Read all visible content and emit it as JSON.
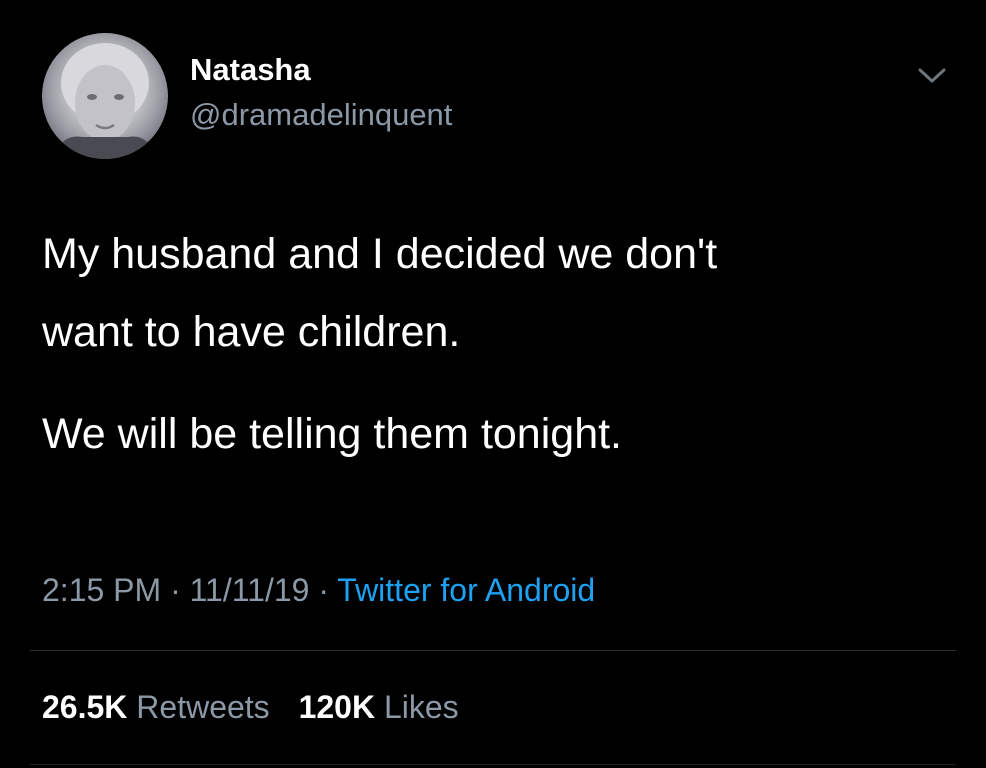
{
  "author": {
    "name": "Natasha",
    "handle": "@dramadelinquent",
    "avatar_icon": "profile-photo"
  },
  "tweet": {
    "lines": [
      "My husband and I decided we don't",
      "want to have children.",
      "We will be telling them tonight."
    ]
  },
  "meta": {
    "time": "2:15 PM",
    "separator": " · ",
    "date": "11/11/19",
    "source": "Twitter for Android"
  },
  "stats": {
    "retweets_count": "26.5K",
    "retweets_label": "Retweets",
    "likes_count": "120K",
    "likes_label": "Likes"
  },
  "icons": {
    "more_menu": "chevron-down-icon"
  },
  "colors": {
    "background": "#000000",
    "primary_text": "#ffffff",
    "secondary_text": "#8b98a5",
    "link": "#1da1f2",
    "divider": "#38444d"
  }
}
